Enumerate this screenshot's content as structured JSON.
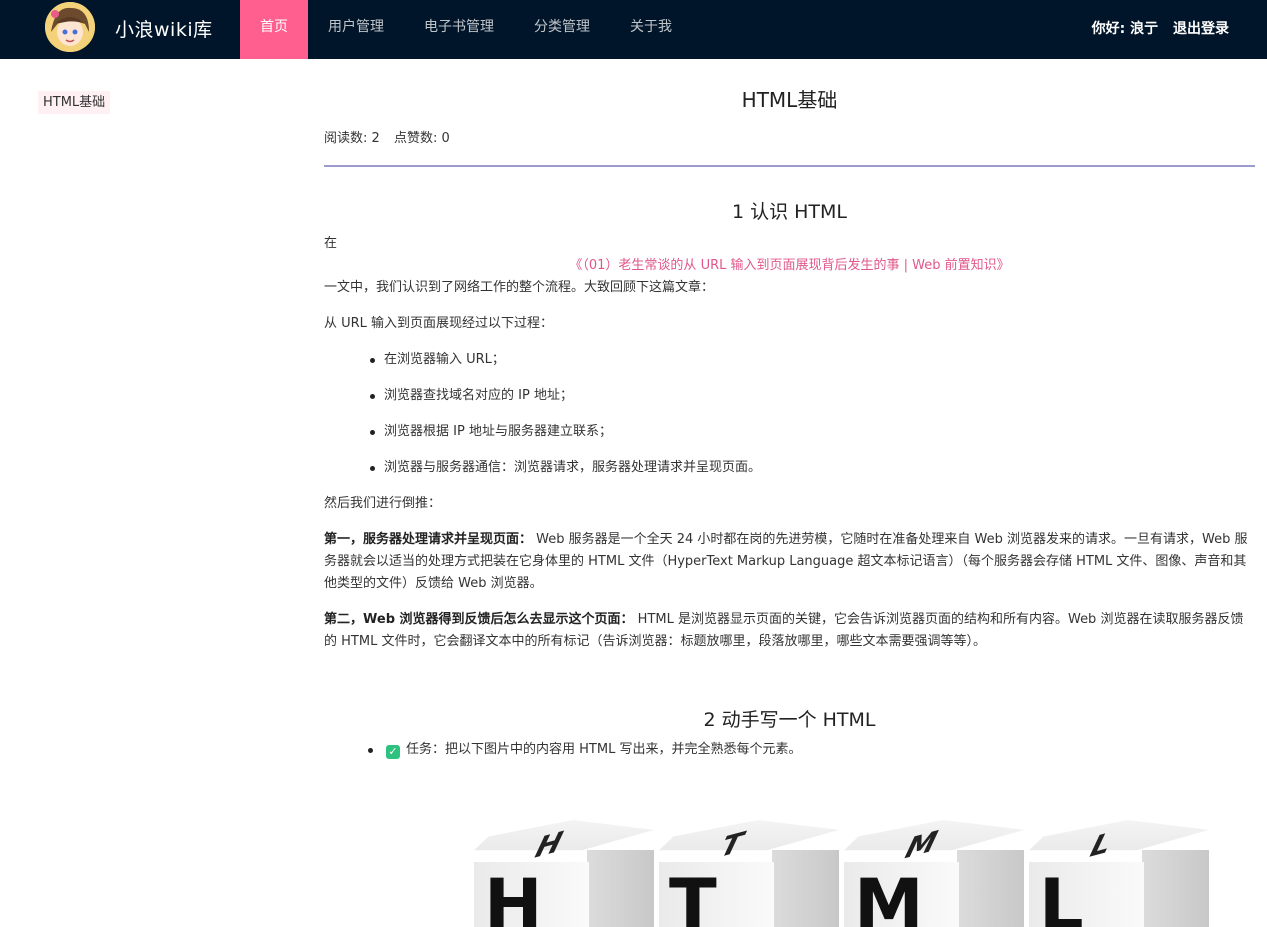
{
  "header": {
    "logo_text": "小浪wiki库",
    "nav": [
      {
        "label": "首页",
        "active": true
      },
      {
        "label": "用户管理",
        "active": false
      },
      {
        "label": "电子书管理",
        "active": false
      },
      {
        "label": "分类管理",
        "active": false
      },
      {
        "label": "关于我",
        "active": false
      }
    ],
    "greeting": "你好: 浪亍",
    "logout": "退出登录"
  },
  "sidebar": {
    "items": [
      {
        "label": "HTML基础"
      }
    ]
  },
  "doc": {
    "title": "HTML基础",
    "read_count": "阅读数: 2",
    "like_count": "点赞数: 0",
    "section1": {
      "heading": "1 认识 HTML",
      "intro_prefix": "在",
      "link": "《（01）老生常谈的从 URL 输入到页面展现背后发生的事 | Web 前置知识》",
      "intro_suffix": "一文中，我们认识到了网络工作的整个流程。大致回顾下这篇文章：",
      "process_intro": "从 URL 输入到页面展现经过以下过程：",
      "steps": [
        "在浏览器输入 URL；",
        "浏览器查找域名对应的 IP 地址；",
        "浏览器根据 IP 地址与服务器建立联系；",
        "浏览器与服务器通信：浏览器请求，服务器处理请求并呈现页面。"
      ],
      "reverse_intro": "然后我们进行倒推：",
      "point1_bold": "第一，服务器处理请求并呈现页面：",
      "point1_text": " Web 服务器是一个全天 24 小时都在岗的先进劳模，它随时在准备处理来自 Web 浏览器发来的请求。一旦有请求，Web 服务器就会以适当的处理方式把装在它身体里的 HTML 文件（HyperText Markup Language 超文本标记语言）（每个服务器会存储 HTML 文件、图像、声音和其他类型的文件）反馈给 Web 浏览器。",
      "point2_bold": "第二，Web 浏览器得到反馈后怎么去显示这个页面：",
      "point2_text": " HTML 是浏览器显示页面的关键，它会告诉浏览器页面的结构和所有内容。Web 浏览器在读取服务器反馈的 HTML 文件时，它会翻译文本中的所有标记（告诉浏览器：标题放哪里，段落放哪里，哪些文本需要强调等等）。"
    },
    "section2": {
      "heading": "2 动手写一个 HTML",
      "task_check": "✓",
      "task": "任务：把以下图片中的内容用 HTML 写出来，并完全熟悉每个元素。"
    },
    "cubes": [
      "H",
      "T",
      "M",
      "L"
    ]
  },
  "colors": {
    "header_bg": "#001529",
    "nav_active": "#ff5f8f",
    "link": "#e0578b",
    "check": "#2ec27e"
  }
}
